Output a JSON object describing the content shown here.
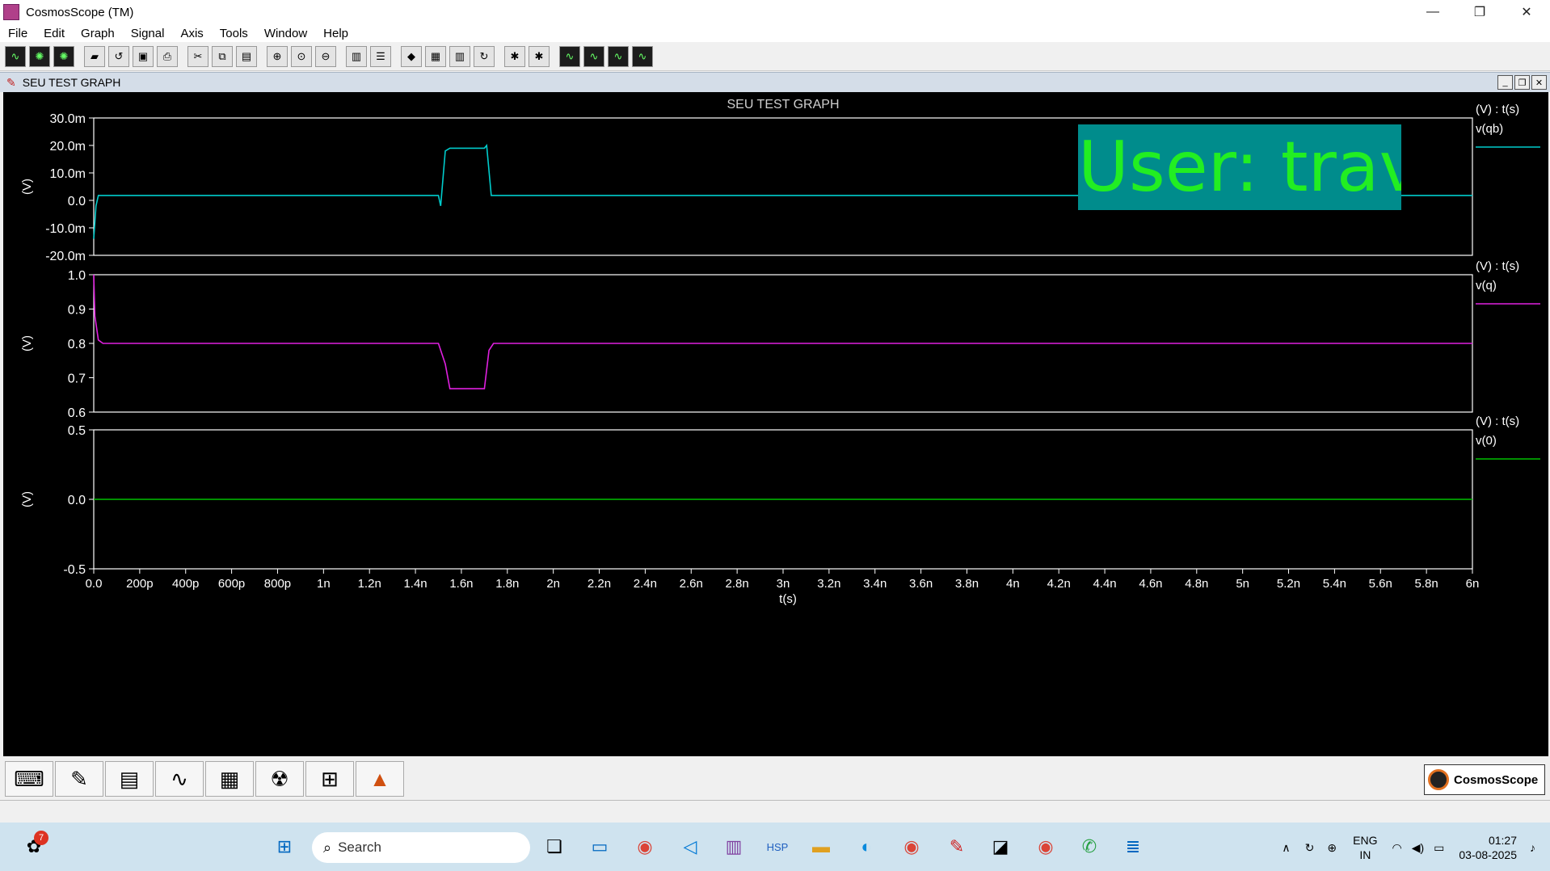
{
  "window": {
    "title": "CosmosScope (TM)",
    "minimize": "—",
    "maximize": "❐",
    "close": "✕"
  },
  "menu": [
    "File",
    "Edit",
    "Graph",
    "Signal",
    "Axis",
    "Tools",
    "Window",
    "Help"
  ],
  "toolbar_icons": [
    "waveform-icon",
    "radar-icon",
    "radar2-icon",
    "open-folder-icon",
    "reload-icon",
    "save-icon",
    "print-icon",
    "cut-icon",
    "copy-icon",
    "paste-icon",
    "zoom-in-icon",
    "zoom-fit-icon",
    "zoom-out-icon",
    "stack-icon",
    "strip-icon",
    "marker-icon",
    "grid-icon",
    "bars-icon",
    "refresh-icon",
    "bug-icon",
    "bug2-icon",
    "measure1-icon",
    "measure2-icon",
    "measure3-icon",
    "measure4-icon"
  ],
  "mdi": {
    "title": "SEU TEST GRAPH"
  },
  "watermark": "User: travi",
  "chart_data": {
    "type": "line",
    "title": "SEU TEST GRAPH",
    "xlabel": "t(s)",
    "x_ticks": [
      "0.0",
      "200p",
      "400p",
      "600p",
      "800p",
      "1n",
      "1.2n",
      "1.4n",
      "1.6n",
      "1.8n",
      "2n",
      "2.2n",
      "2.4n",
      "2.6n",
      "2.8n",
      "3n",
      "3.2n",
      "3.4n",
      "3.6n",
      "3.8n",
      "4n",
      "4.2n",
      "4.4n",
      "4.6n",
      "4.8n",
      "5n",
      "5.2n",
      "5.4n",
      "5.6n",
      "5.8n",
      "6n"
    ],
    "xlim": [
      0,
      6e-09
    ],
    "panels": [
      {
        "name": "v(qb)",
        "units_label": "(V) : t(s)",
        "ylabel": "(V)",
        "color": "#00cccc",
        "y_ticks": [
          "30.0m",
          "20.0m",
          "10.0m",
          "0.0",
          "-10.0m",
          "-20.0m"
        ],
        "ylim": [
          -0.02,
          0.03
        ],
        "points": [
          [
            0,
            -0.014
          ],
          [
            1e-11,
            -0.002
          ],
          [
            2e-11,
            0.0018
          ],
          [
            1.5e-09,
            0.0018
          ],
          [
            1.51e-09,
            -0.002
          ],
          [
            1.53e-09,
            0.018
          ],
          [
            1.55e-09,
            0.019
          ],
          [
            1.7e-09,
            0.019
          ],
          [
            1.71e-09,
            0.02
          ],
          [
            1.73e-09,
            0.0018
          ],
          [
            6e-09,
            0.0018
          ]
        ]
      },
      {
        "name": "v(q)",
        "units_label": "(V) : t(s)",
        "ylabel": "(V)",
        "color": "#e020e0",
        "y_ticks": [
          "1.0",
          "0.9",
          "0.8",
          "0.7",
          "0.6"
        ],
        "ylim": [
          0.6,
          1.0
        ],
        "points": [
          [
            0,
            1.0
          ],
          [
            5e-12,
            0.88
          ],
          [
            2e-11,
            0.81
          ],
          [
            4e-11,
            0.8
          ],
          [
            1.5e-09,
            0.8
          ],
          [
            1.53e-09,
            0.74
          ],
          [
            1.55e-09,
            0.668
          ],
          [
            1.7e-09,
            0.668
          ],
          [
            1.72e-09,
            0.78
          ],
          [
            1.74e-09,
            0.8
          ],
          [
            6e-09,
            0.8
          ]
        ]
      },
      {
        "name": "v(0)",
        "units_label": "(V) : t(s)",
        "ylabel": "(V)",
        "color": "#00c000",
        "y_ticks": [
          "0.5",
          "0.0",
          "-0.5"
        ],
        "ylim": [
          -0.5,
          0.5
        ],
        "points": [
          [
            0,
            0
          ],
          [
            6e-09,
            0
          ]
        ]
      }
    ]
  },
  "bottom_tools": [
    "keyboard-icon",
    "pen-icon",
    "scope-icon",
    "signal-icon",
    "calculator-icon",
    "radiation-icon",
    "schematic-icon",
    "matlab-icon"
  ],
  "brand": "CosmosScope",
  "taskbar": {
    "notification_count": "7",
    "search_placeholder": "Search",
    "language": "ENG",
    "region": "IN",
    "time": "01:27",
    "date": "03-08-2025"
  }
}
